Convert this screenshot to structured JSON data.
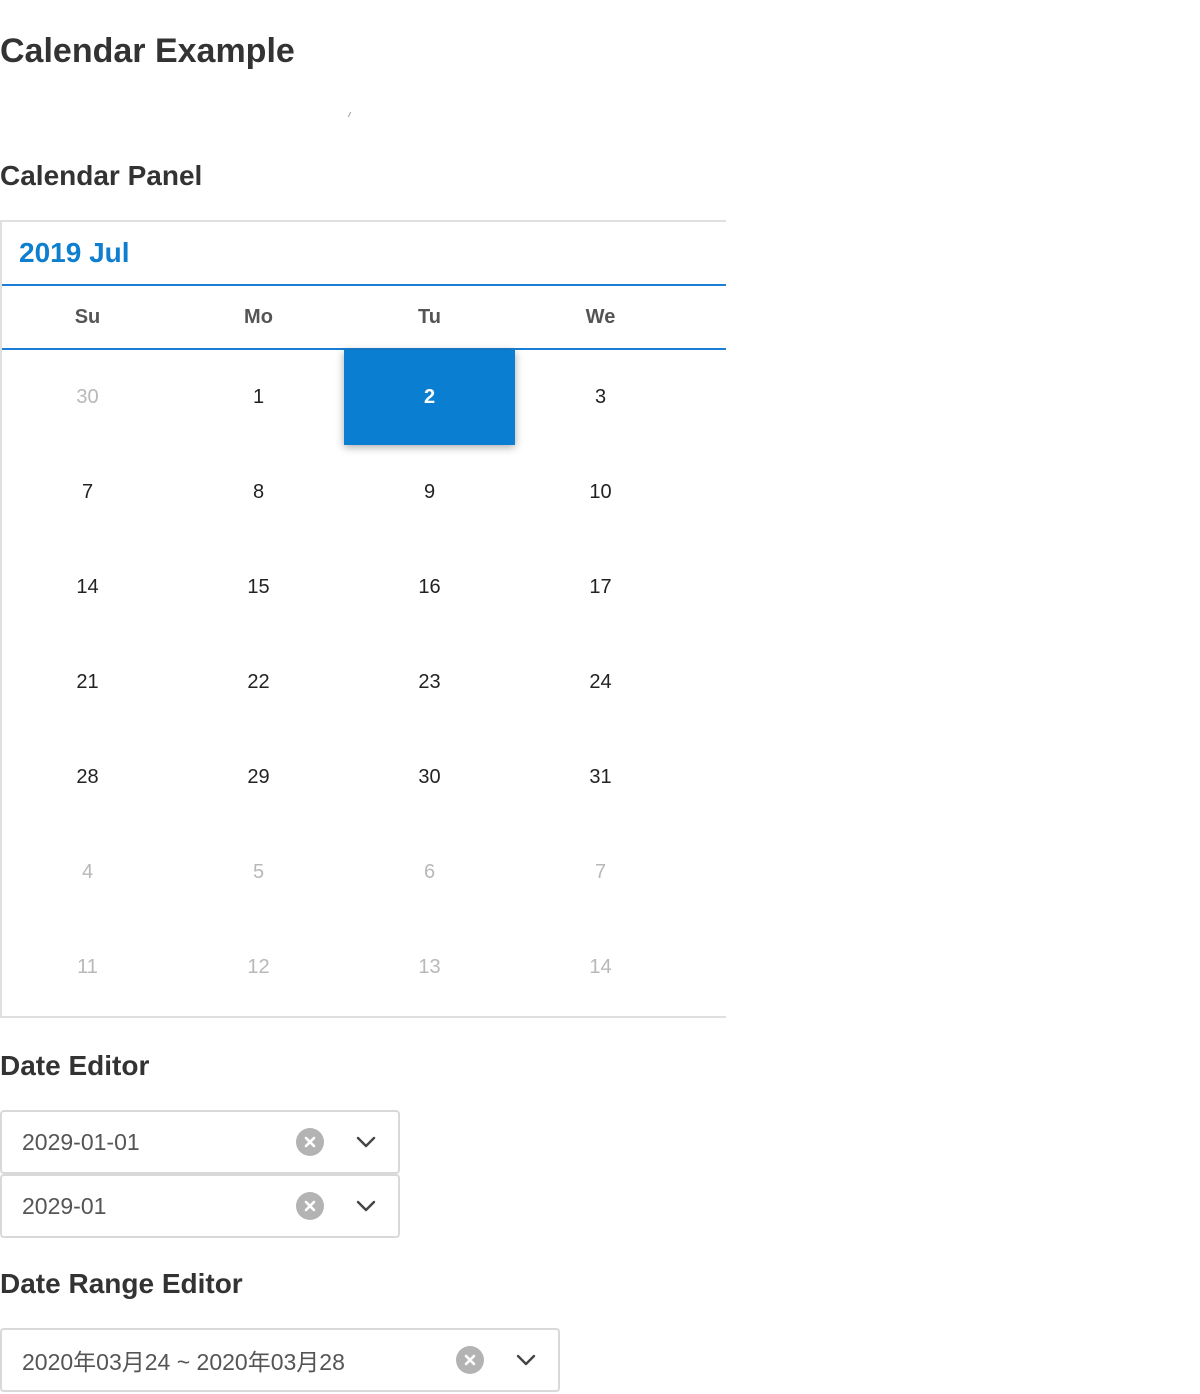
{
  "page": {
    "title": "Calendar Example"
  },
  "calendar_panel": {
    "section_title": "Calendar Panel",
    "month_label": "2019 Jul",
    "weekdays": [
      "Su",
      "Mo",
      "Tu",
      "We"
    ],
    "weeks": [
      [
        {
          "d": "30",
          "muted": true
        },
        {
          "d": "1"
        },
        {
          "d": "2",
          "selected": true
        },
        {
          "d": "3"
        }
      ],
      [
        {
          "d": "7"
        },
        {
          "d": "8"
        },
        {
          "d": "9"
        },
        {
          "d": "10"
        }
      ],
      [
        {
          "d": "14"
        },
        {
          "d": "15"
        },
        {
          "d": "16"
        },
        {
          "d": "17"
        }
      ],
      [
        {
          "d": "21"
        },
        {
          "d": "22"
        },
        {
          "d": "23"
        },
        {
          "d": "24"
        }
      ],
      [
        {
          "d": "28"
        },
        {
          "d": "29"
        },
        {
          "d": "30"
        },
        {
          "d": "31"
        }
      ],
      [
        {
          "d": "4",
          "muted": true
        },
        {
          "d": "5",
          "muted": true
        },
        {
          "d": "6",
          "muted": true
        },
        {
          "d": "7",
          "muted": true
        }
      ],
      [
        {
          "d": "11",
          "muted": true
        },
        {
          "d": "12",
          "muted": true
        },
        {
          "d": "13",
          "muted": true
        },
        {
          "d": "14",
          "muted": true
        }
      ]
    ],
    "accent_color": "#0a7fd2",
    "muted_color": "#b8b8b8"
  },
  "date_editor": {
    "section_title": "Date Editor",
    "date_value": "2029-01-01",
    "month_value": "2029-01",
    "clear_icon": "clear-circle-icon",
    "dropdown_icon": "chevron-down-icon"
  },
  "date_range_editor": {
    "section_title": "Date Range Editor",
    "range_value": "2020年03月24 ~ 2020年03月28",
    "clear_icon": "clear-circle-icon",
    "dropdown_icon": "chevron-down-icon"
  }
}
